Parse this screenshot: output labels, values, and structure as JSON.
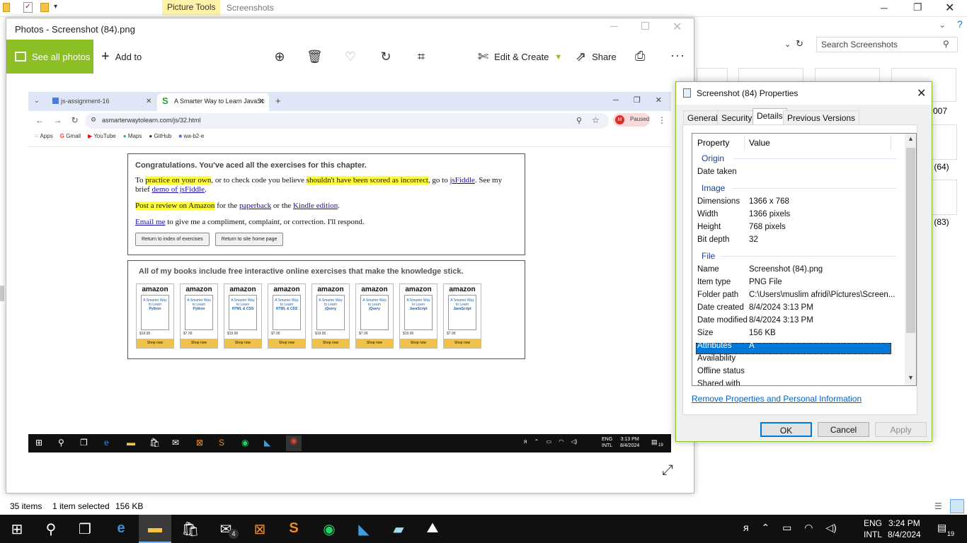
{
  "explorer": {
    "ribbon_tab": "Picture Tools",
    "ribbon_title": "Screenshots",
    "search_placeholder": "Search Screenshots",
    "thumb_labels": [
      "007",
      "ot (64)",
      "ot (83)"
    ],
    "status_items": "35 items",
    "status_selected": "1 item selected",
    "status_size": "156 KB"
  },
  "photos": {
    "title": "Photos - Screenshot (84).png",
    "see_all": "See all photos",
    "add_to": "Add to",
    "edit_create": "Edit & Create",
    "share": "Share",
    "accent_color": "#8cbf26"
  },
  "inner": {
    "tab1": "js-assignment-16",
    "tab2": "A Smarter Way to Learn JavaSc",
    "url": "asmarterwaytolearn.com/js/32.html",
    "paused": "Paused",
    "profile_initial": "M",
    "bookmarks": [
      "Apps",
      "Gmail",
      "YouTube",
      "Maps",
      "GitHub",
      "wa-b2-e"
    ],
    "congrats": "Congratulations. You've aced all the exercises for this chapter.",
    "p1": {
      "a": "To ",
      "hl1": "practice on your own",
      "b": ", or to check code you believe ",
      "hl2": "shouldn't have been scored as incorrect",
      "c": ", go to ",
      "link1": "jsFiddle",
      "d": ". See my brief ",
      "link2": "demo of jsFiddle",
      "e": "."
    },
    "p2": {
      "hl": "Post a review on Amazon",
      "a": " for the ",
      "link1": "paperback",
      "b": " or the ",
      "link2": "Kindle edition",
      "c": "."
    },
    "p3": {
      "link": "Email me",
      "a": " to give me a compliment, complaint, or correction. I'll respond."
    },
    "btn_index": "Return to index of exercises",
    "btn_home": "Return to site home page",
    "books_title": "All of my books include free interactive online exercises that make the knowledge stick.",
    "books": [
      {
        "topic": "Python",
        "price": "$19.95"
      },
      {
        "topic": "Python",
        "price": "$7.99"
      },
      {
        "topic": "HTML & CSS",
        "price": "$19.95"
      },
      {
        "topic": "HTML & CSS",
        "price": "$7.99"
      },
      {
        "topic": "jQuery",
        "price": "$19.95"
      },
      {
        "topic": "jQuery",
        "price": "$7.99"
      },
      {
        "topic": "JavaScript",
        "price": "$19.95"
      },
      {
        "topic": "JavaScript",
        "price": "$7.99"
      }
    ],
    "book_brand": "amazon",
    "book_cover_prefix": "A Smarter Way to Learn",
    "shop_now": "Shop now",
    "lang": "ENG",
    "lang2": "INTL",
    "time": "3:13 PM",
    "date": "8/4/2024",
    "notif_count": "19"
  },
  "props": {
    "title": "Screenshot (84) Properties",
    "tabs": [
      "General",
      "Security",
      "Details",
      "Previous Versions"
    ],
    "col_property": "Property",
    "col_value": "Value",
    "groups": {
      "origin": "Origin",
      "image": "Image",
      "file": "File"
    },
    "rows": {
      "date_taken": {
        "label": "Date taken",
        "value": ""
      },
      "dimensions": {
        "label": "Dimensions",
        "value": "1366 x 768"
      },
      "width": {
        "label": "Width",
        "value": "1366 pixels"
      },
      "height": {
        "label": "Height",
        "value": "768 pixels"
      },
      "bit_depth": {
        "label": "Bit depth",
        "value": "32"
      },
      "name": {
        "label": "Name",
        "value": "Screenshot (84).png"
      },
      "item_type": {
        "label": "Item type",
        "value": "PNG File"
      },
      "folder_path": {
        "label": "Folder path",
        "value": "C:\\Users\\muslim afridi\\Pictures\\Screen..."
      },
      "date_created": {
        "label": "Date created",
        "value": "8/4/2024 3:13 PM"
      },
      "date_modified": {
        "label": "Date modified",
        "value": "8/4/2024 3:13 PM"
      },
      "size": {
        "label": "Size",
        "value": "156 KB"
      },
      "attributes": {
        "label": "Attributes",
        "value": "A"
      },
      "availability": {
        "label": "Availability",
        "value": ""
      },
      "offline_status": {
        "label": "Offline status",
        "value": ""
      },
      "shared_with": {
        "label": "Shared with",
        "value": ""
      }
    },
    "remove_link": "Remove Properties and Personal Information",
    "ok": "OK",
    "cancel": "Cancel",
    "apply": "Apply"
  },
  "taskbar": {
    "lang": "ENG",
    "lang2": "INTL",
    "time": "3:24 PM",
    "date": "8/4/2024",
    "mail_badge": "4",
    "notif_count": "19"
  }
}
